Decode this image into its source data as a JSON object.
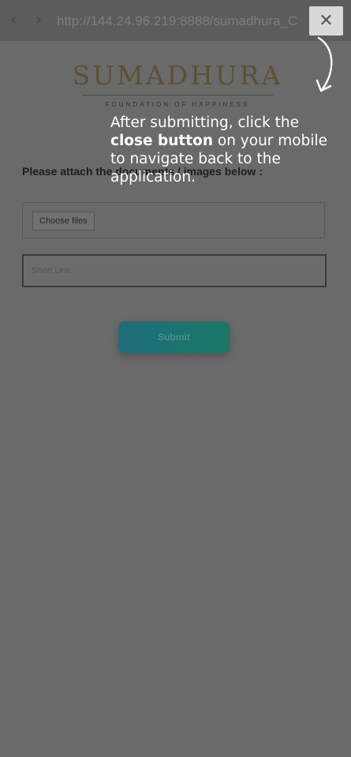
{
  "browser": {
    "back_icon": "chevron-left-icon",
    "forward_icon": "chevron-right-icon",
    "back_glyph": "‹",
    "forward_glyph": "›",
    "url": "http://144.24.96.219:8888/sumadhura_C",
    "close_icon": "close-icon",
    "close_glyph": "✕"
  },
  "logo": {
    "wordmark": "SUMADHURA",
    "tagline": "FOUNDATION OF HAPPINESS"
  },
  "form": {
    "heading": "Please attach the documents / images below :",
    "choose_files_label": "Choose files",
    "short_input_placeholder": "Short Unit",
    "submit_label": "Submit"
  },
  "overlay": {
    "hint_prefix": "After submitting, click the ",
    "hint_bold": "close button",
    "hint_suffix": " on your mobile to navigate back to the application.",
    "arrow_icon": "curved-arrow-icon"
  },
  "colors": {
    "dim_background": "#6a6a6a",
    "close_button_bg": "#d8d8d8",
    "submit_gradient_start": "#1e6d7c",
    "submit_gradient_end": "#1a7866",
    "hint_text": "#ffffff"
  }
}
